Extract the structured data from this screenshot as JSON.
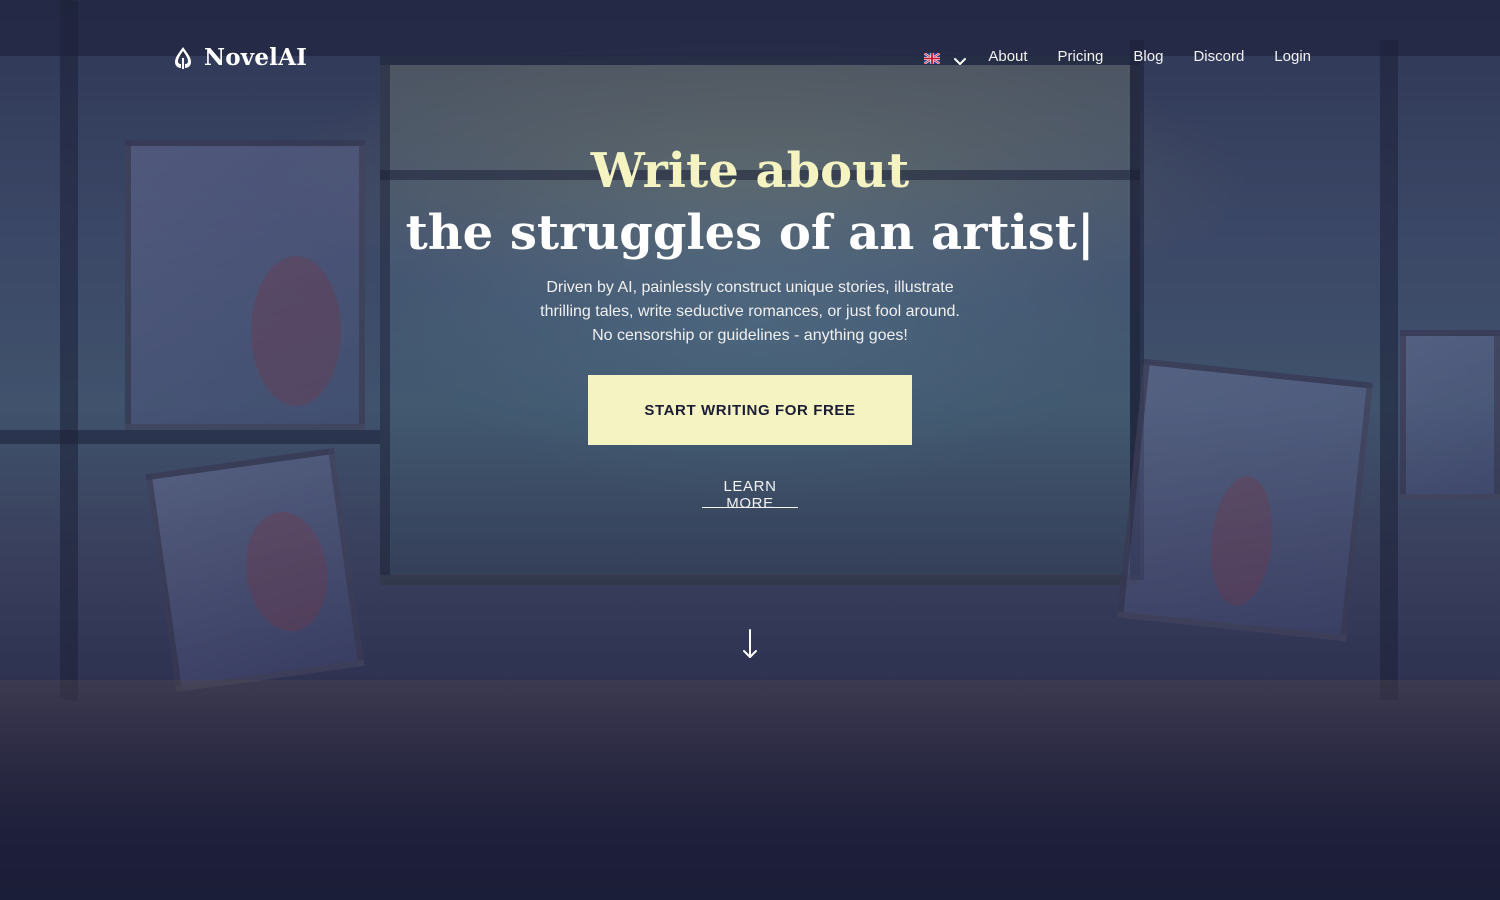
{
  "brand": {
    "name": "NovelAI",
    "logo_icon": "quill-pen-icon"
  },
  "nav": {
    "language_flag": "uk-flag-icon",
    "language_chevron": "chevron-down-icon",
    "links": [
      "About",
      "Pricing",
      "Blog",
      "Discord",
      "Login"
    ]
  },
  "hero": {
    "headline_line1": "Write about",
    "headline_line2": "the struggles of an artist|",
    "subtitle_lines": [
      "Driven by AI, painlessly construct unique stories, illustrate",
      "thrilling tales, write seductive romances, or just fool around.",
      "No censorship or guidelines - anything goes!"
    ],
    "cta_label": "START WRITING FOR FREE",
    "learn_more_label": "LEARN MORE",
    "scroll_icon": "arrow-down-icon"
  },
  "colors": {
    "accent": "#f5f3c2",
    "background": "#1b1d36",
    "text": "#ffffff"
  }
}
